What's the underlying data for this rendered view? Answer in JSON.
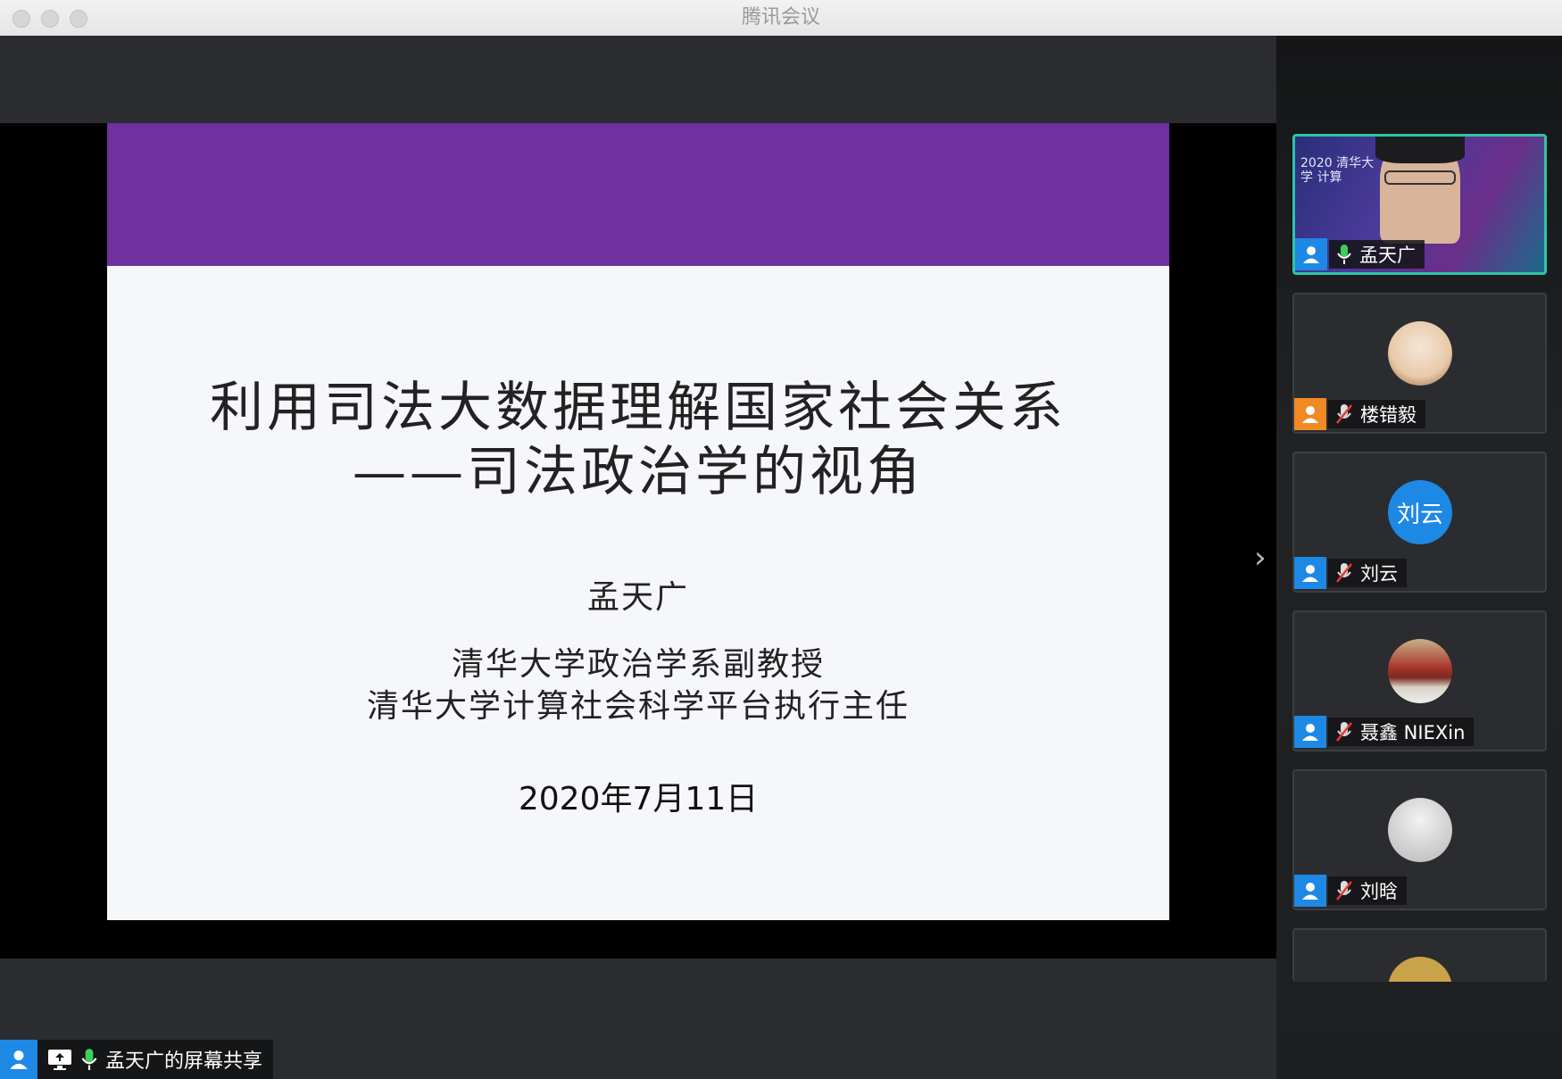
{
  "window": {
    "title": "腾讯会议"
  },
  "slide": {
    "title_line1": "利用司法大数据理解国家社会关系",
    "title_line2": "——司法政治学的视角",
    "author": "孟天广",
    "affiliation_1": "清华大学政治学系副教授",
    "affiliation_2": "清华大学计算社会科学平台执行主任",
    "date": "2020年7月11日",
    "band_color": "#7030a0"
  },
  "participants": [
    {
      "name": "孟天广",
      "mic": "on",
      "active": true,
      "video_banner": "2020 清华大学 计算"
    },
    {
      "name": "楼错毅",
      "mic": "muted",
      "role": "host"
    },
    {
      "name": "刘云",
      "mic": "muted",
      "avatar_text": "刘云"
    },
    {
      "name": "聂鑫 NIEXin",
      "mic": "muted"
    },
    {
      "name": "刘晗",
      "mic": "muted"
    }
  ],
  "screen_share": {
    "label": "孟天广的屏幕共享"
  },
  "colors": {
    "accent": "#2ec4a8",
    "user_badge": "#1e88e5",
    "host_badge": "#f08a24",
    "mic_on": "#3ccf5a"
  }
}
